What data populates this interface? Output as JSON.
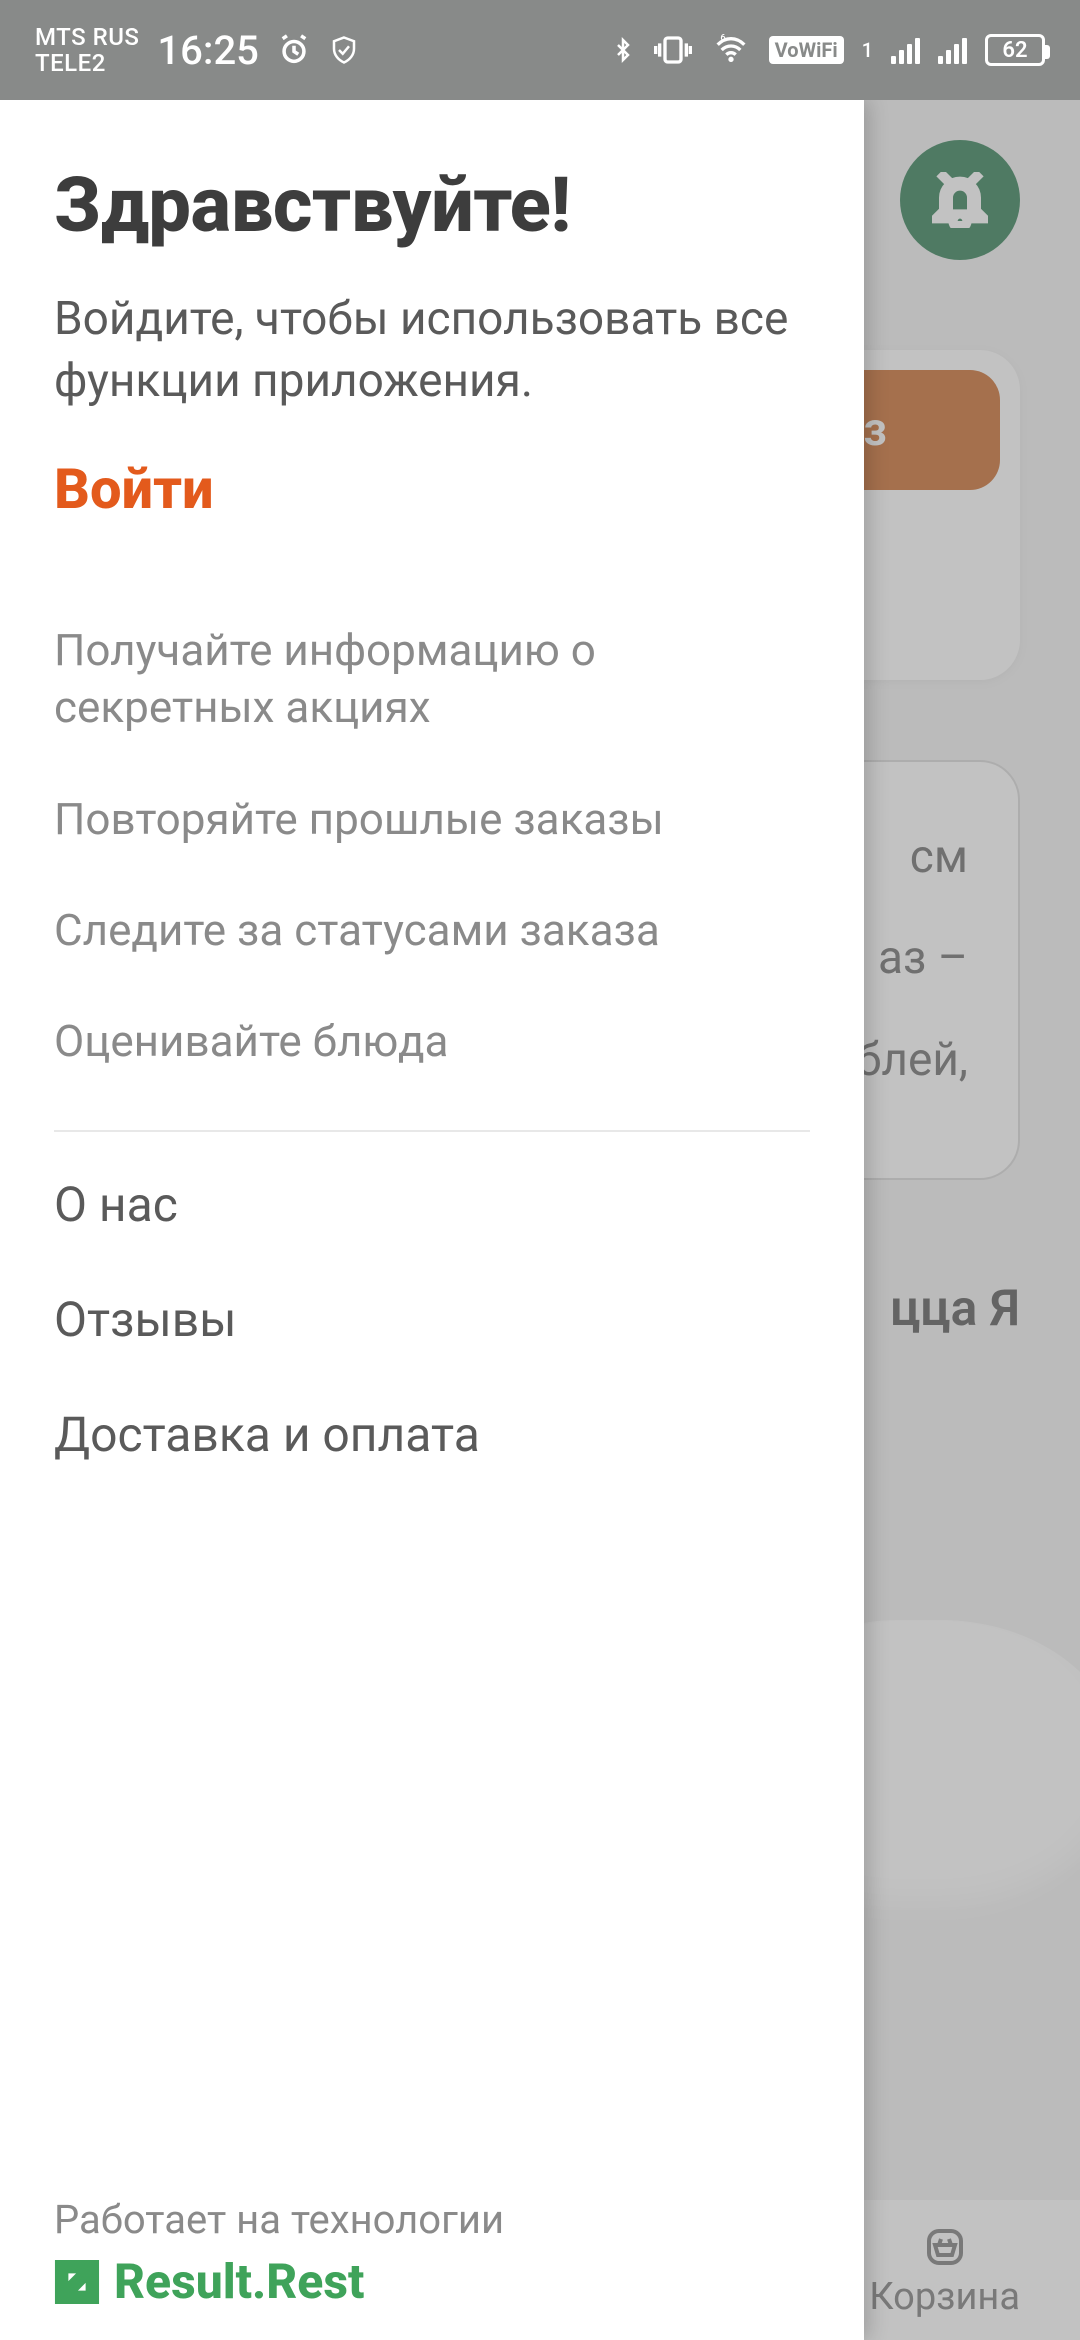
{
  "status_bar": {
    "carrier1": "MTS RUS",
    "carrier2": "TELE2",
    "time": "16:25",
    "vowifi": "VoWiFi",
    "dual_sim_index": "1",
    "battery": "62"
  },
  "drawer": {
    "title": "Здравствуйте!",
    "subtitle": "Войдите, чтобы использовать все функции приложения.",
    "login": "Войти",
    "features": [
      "Получайте информацию о секретных акциях",
      "Повторяйте прошлые заказы",
      "Следите за статусами заказа",
      "Оценивайте блюда"
    ],
    "links": [
      "О нас",
      "Отзывы",
      "Доставка и оплата"
    ],
    "powered_by": "Работает на технологии",
    "brand": "Result.Rest"
  },
  "background": {
    "promo_badge_fragment": "з",
    "info_lines": [
      "см",
      "аз –",
      "блей,"
    ],
    "category_fragment": "цца   Я",
    "cart_label": "Корзина"
  }
}
